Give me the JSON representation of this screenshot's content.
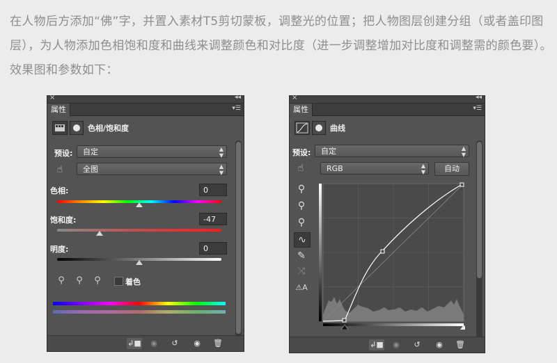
{
  "intro": {
    "text": "在人物后方添加“佛”字，并置入素材T5剪切蒙板，调整光的位置；把人物图层创建分组（或者盖印图层），为人物添加色相饱和度和曲线来调整颜色和对比度（进一步调整增加对比度和调整需的颜色要）。效果图和参数如下："
  },
  "hue_panel": {
    "tab_label": "属性",
    "title": "色相/饱和度",
    "preset_label": "预设:",
    "preset_value": "自定",
    "channel_value": "全图",
    "hue_label": "色相:",
    "hue_value": "0",
    "hue_level": 0.5,
    "sat_label": "饱和度:",
    "sat_value": "-47",
    "sat_level": 0.26,
    "light_label": "明度:",
    "light_value": "0",
    "light_level": 0.5,
    "colorize_label": "着色",
    "colorize_checked": false
  },
  "curves_panel": {
    "tab_label": "属性",
    "title": "曲线",
    "preset_label": "预设:",
    "preset_value": "自定",
    "channel_value": "RGB",
    "auto_label": "自动"
  },
  "colors": {
    "page_bg": "#ececec",
    "intro_text": "#8e8e8e",
    "panel_bg": "#535353",
    "curve_line": "#ffffff"
  }
}
